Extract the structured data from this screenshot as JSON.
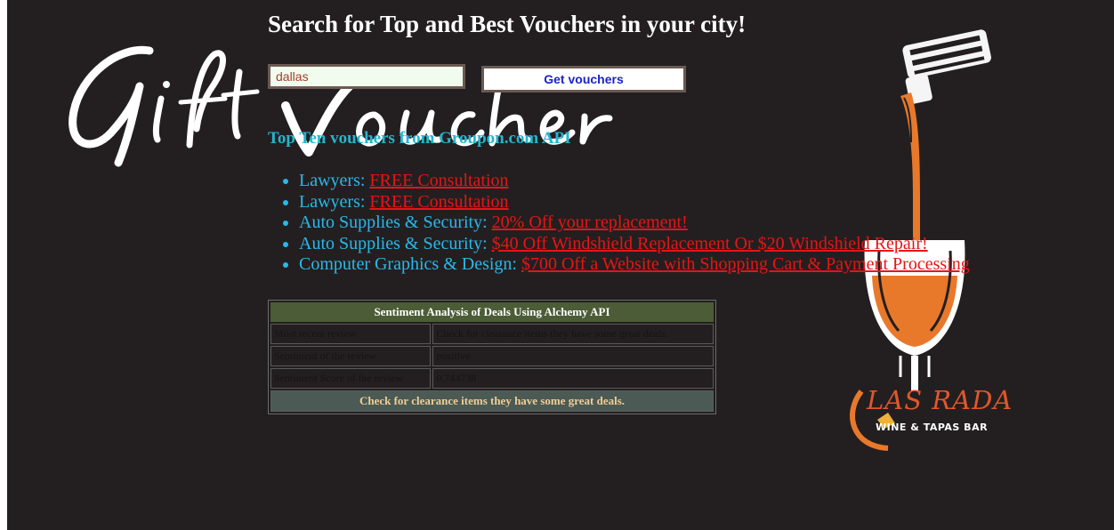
{
  "header": {
    "headline": "Search for Top and Best Vouchers in your city!"
  },
  "logo": {
    "text": "Gift Voucher"
  },
  "search": {
    "city_value": "dallas",
    "button_label": "Get vouchers"
  },
  "vouchers": {
    "title": "Top Ten vouchers from Groupon.com API",
    "items": [
      {
        "category": "Lawyers:",
        "deal": "FREE Consultation"
      },
      {
        "category": "Lawyers:",
        "deal": "FREE Consultation"
      },
      {
        "category": "Auto Supplies & Security:",
        "deal": "20% Off your replacement!"
      },
      {
        "category": "Auto Supplies & Security:",
        "deal": "$40 Off Windshield Replacement Or $20 Windshield Repair!"
      },
      {
        "category": "Computer Graphics & Design:",
        "deal": "$700 Off a Website with Shopping Cart & Payment Processing"
      }
    ]
  },
  "sentiment": {
    "title": "Sentiment Analysis of Deals Using Alchemy API",
    "rows": [
      {
        "label": "Most recent review",
        "value": "Check for clearance items they have some great deals."
      },
      {
        "label": "Sentiment of the review",
        "value": "positive"
      },
      {
        "label": "Sentiment Score of the review",
        "value": "0.744738"
      }
    ],
    "summary": "Check for clearance items they have some great deals."
  },
  "brand": {
    "name": "LAS RADA",
    "tagline": "WINE & TAPAS BAR"
  },
  "colors": {
    "background": "#231f20",
    "link": "#e81414",
    "list_text": "#2ab8ea",
    "section_title": "#22b6ce",
    "table_header": "#4b5c36",
    "brand_orange": "#e0572a"
  }
}
